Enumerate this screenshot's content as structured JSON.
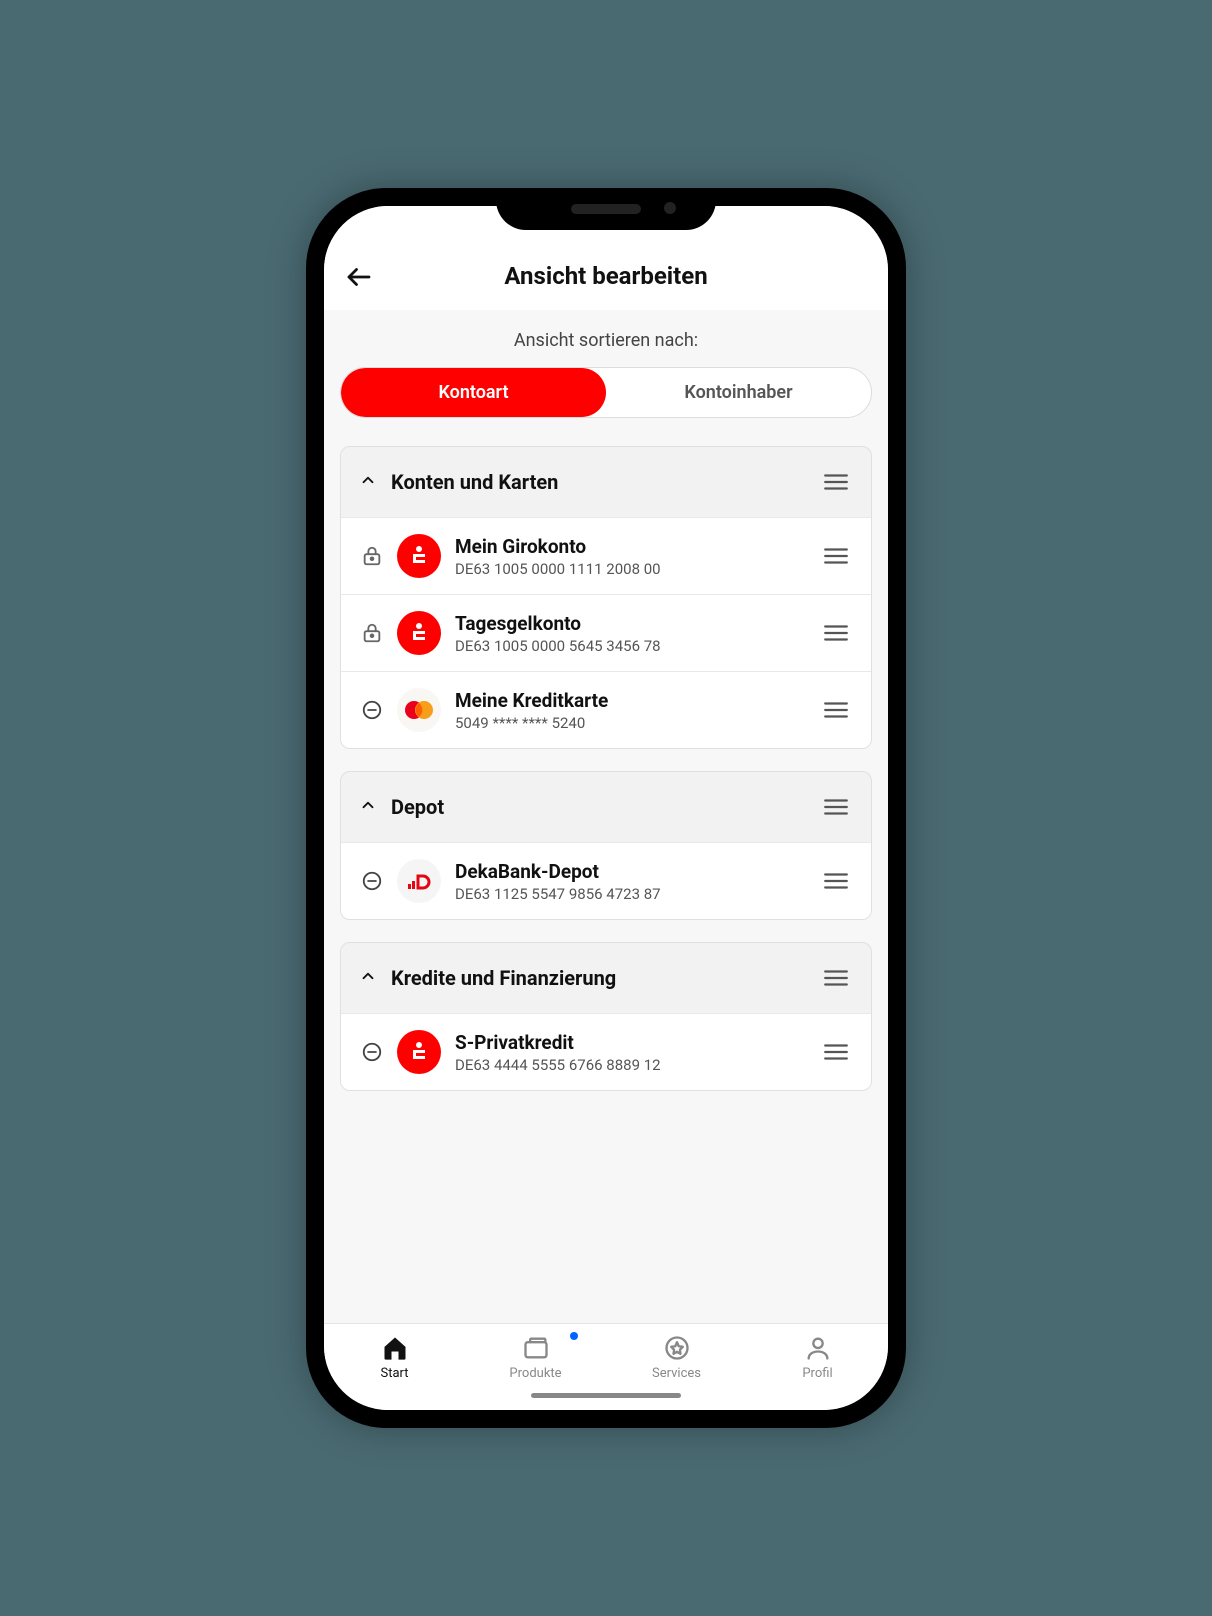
{
  "header": {
    "title": "Ansicht bearbeiten"
  },
  "sort": {
    "label": "Ansicht sortieren nach:",
    "opt1": "Kontoart",
    "opt2": "Kontoinhaber"
  },
  "groups": [
    {
      "title": "Konten und Karten",
      "items": [
        {
          "status": "lock",
          "brand": "sparkasse",
          "name": "Mein Girokonto",
          "number": "DE63 1005 0000 1111 2008 00"
        },
        {
          "status": "lock",
          "brand": "sparkasse",
          "name": "Tagesgelkonto",
          "number": "DE63 1005 0000 5645 3456 78"
        },
        {
          "status": "remove",
          "brand": "mastercard",
          "name": "Meine Kreditkarte",
          "number": "5049 **** **** 5240"
        }
      ]
    },
    {
      "title": "Depot",
      "items": [
        {
          "status": "remove",
          "brand": "deka",
          "name": "DekaBank-Depot",
          "number": "DE63 1125 5547 9856 4723 87"
        }
      ]
    },
    {
      "title": "Kredite und Finanzierung",
      "items": [
        {
          "status": "remove",
          "brand": "sparkasse",
          "name": "S-Privatkredit",
          "number": "DE63 4444 5555 6766 8889 12"
        }
      ]
    }
  ],
  "nav": {
    "start": "Start",
    "produkte": "Produkte",
    "services": "Services",
    "profil": "Profil"
  },
  "colors": {
    "accent": "#ff0000"
  }
}
